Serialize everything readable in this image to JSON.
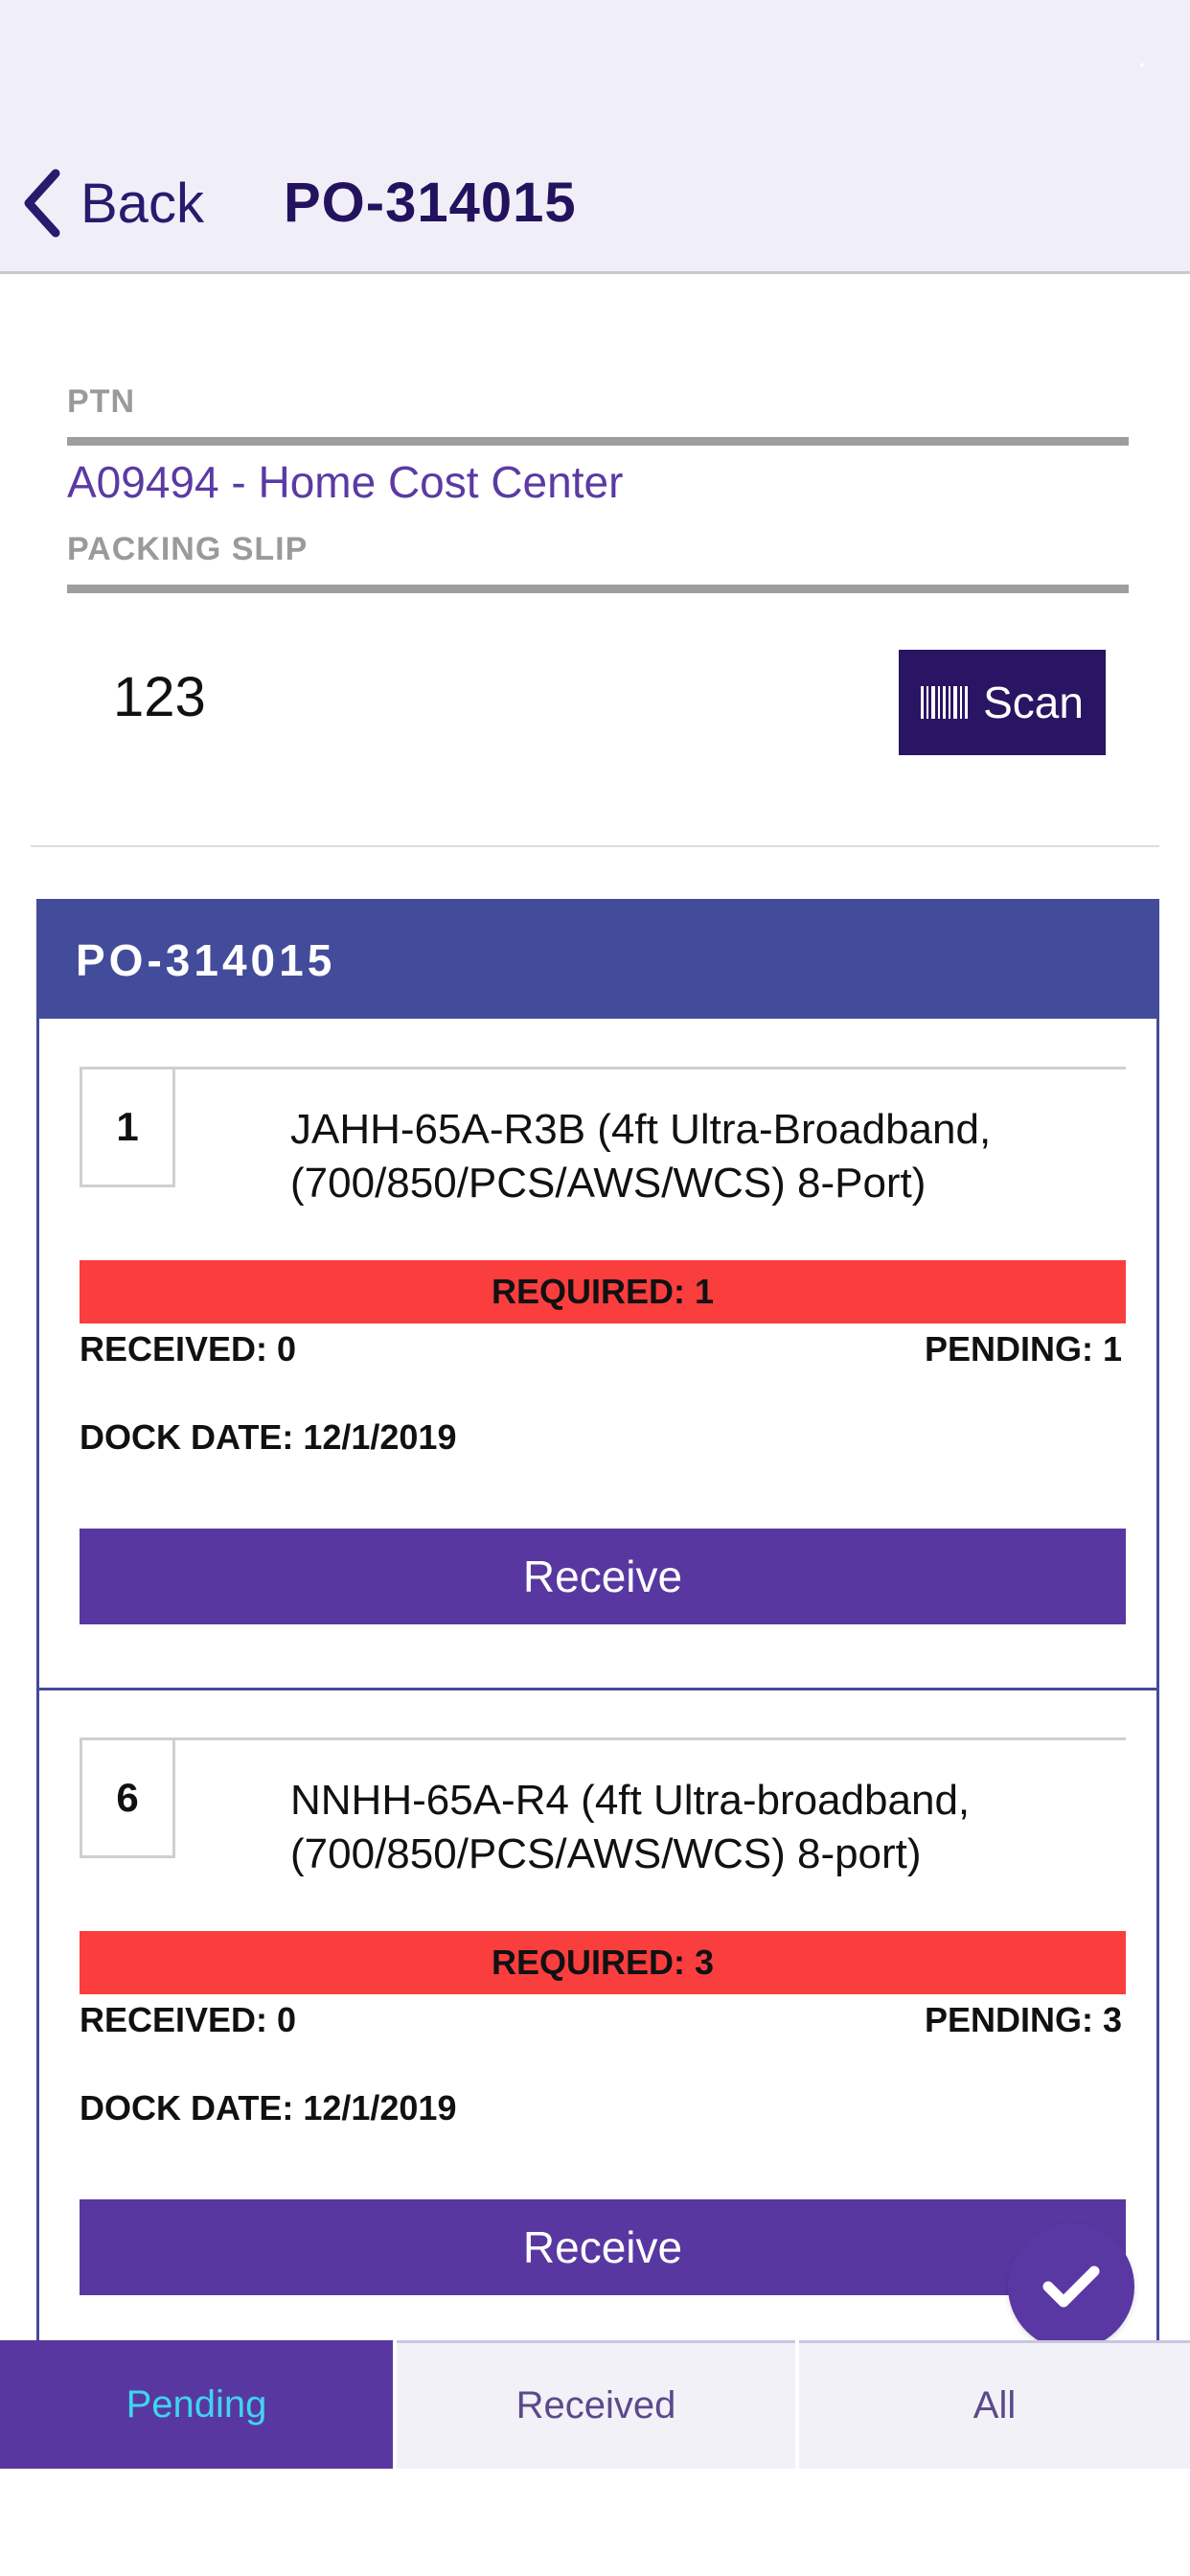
{
  "nav": {
    "back_label": "Back",
    "title": "PO-314015"
  },
  "form": {
    "ptn_label": "PTN",
    "ptn_value": "A09494 - Home Cost Center",
    "packing_slip_label": "PACKING SLIP",
    "packing_slip_value": "123",
    "scan_label": "Scan"
  },
  "po_card": {
    "title": "PO-314015",
    "items": [
      {
        "qty": "1",
        "description_line1": "JAHH-65A-R3B (4ft Ultra-Broadband,",
        "description_line2": "(700/850/PCS/AWS/WCS) 8-Port)",
        "required": "REQUIRED: 1",
        "received": "RECEIVED: 0",
        "pending": "PENDING: 1",
        "dock_date": "DOCK DATE: 12/1/2019",
        "receive_label": "Receive"
      },
      {
        "qty": "6",
        "description_line1": "NNHH-65A-R4 (4ft Ultra-broadband,",
        "description_line2": "(700/850/PCS/AWS/WCS) 8-port)",
        "required": "REQUIRED: 3",
        "received": "RECEIVED: 0",
        "pending": "PENDING: 3",
        "dock_date": "DOCK DATE: 12/1/2019",
        "receive_label": "Receive"
      }
    ]
  },
  "tabs": {
    "active": "Pending",
    "items": [
      {
        "label": "Pending"
      },
      {
        "label": "Received"
      },
      {
        "label": "All"
      }
    ]
  },
  "fab": {
    "icon": "checkmark-icon"
  },
  "colors": {
    "nav_background": "#f0eff8",
    "brand_dark": "#2a1464",
    "brand_purple": "#5838a0",
    "po_header": "#434b9b",
    "required_red": "#fa3e3e",
    "active_tab_text": "#3fd4f0"
  }
}
